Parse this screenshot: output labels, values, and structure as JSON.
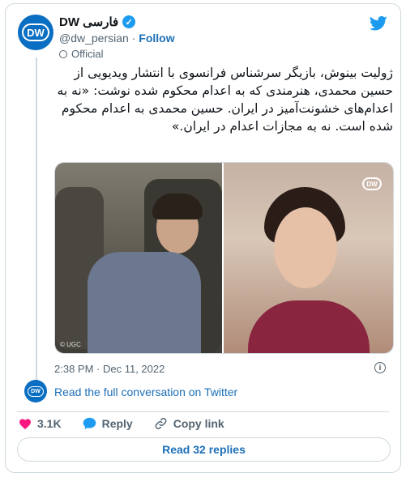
{
  "account": {
    "name": "DW فارسی",
    "handle": "@dw_persian",
    "separator": "·",
    "follow_label": "Follow",
    "official_label": "Official",
    "avatar_text": "DW"
  },
  "tweet": {
    "text": "ژولیت بینوش، بازیگر سرشناس فرانسوی با انتشار ویدیویی از حسین محمدی، هنرمندی که به اعدام محکوم شده نوشت: «نه به اعدام‌های خشونت‌آمیز در ایران. حسین محمدی به اعدام محکوم شده است. نه به مجازات اعدام در ایران.»",
    "timestamp": "2:38 PM · Dec 11, 2022",
    "media_left_caption": "© UGC",
    "media_right_badge": "DW"
  },
  "conversation": {
    "link_label": "Read the full conversation on Twitter",
    "avatar_text": "DW"
  },
  "actions": {
    "like_count": "3.1K",
    "reply_label": "Reply",
    "copy_link_label": "Copy link",
    "read_replies_label": "Read 32 replies"
  },
  "colors": {
    "accent": "#1d6fb8",
    "twitter_blue": "#1d9bf0",
    "heart": "#f91880",
    "dw_blue": "#0a6fc2"
  },
  "icons": [
    "twitter-bird-icon",
    "verified-icon",
    "official-icon",
    "info-icon",
    "heart-icon",
    "reply-icon",
    "copy-link-icon"
  ]
}
